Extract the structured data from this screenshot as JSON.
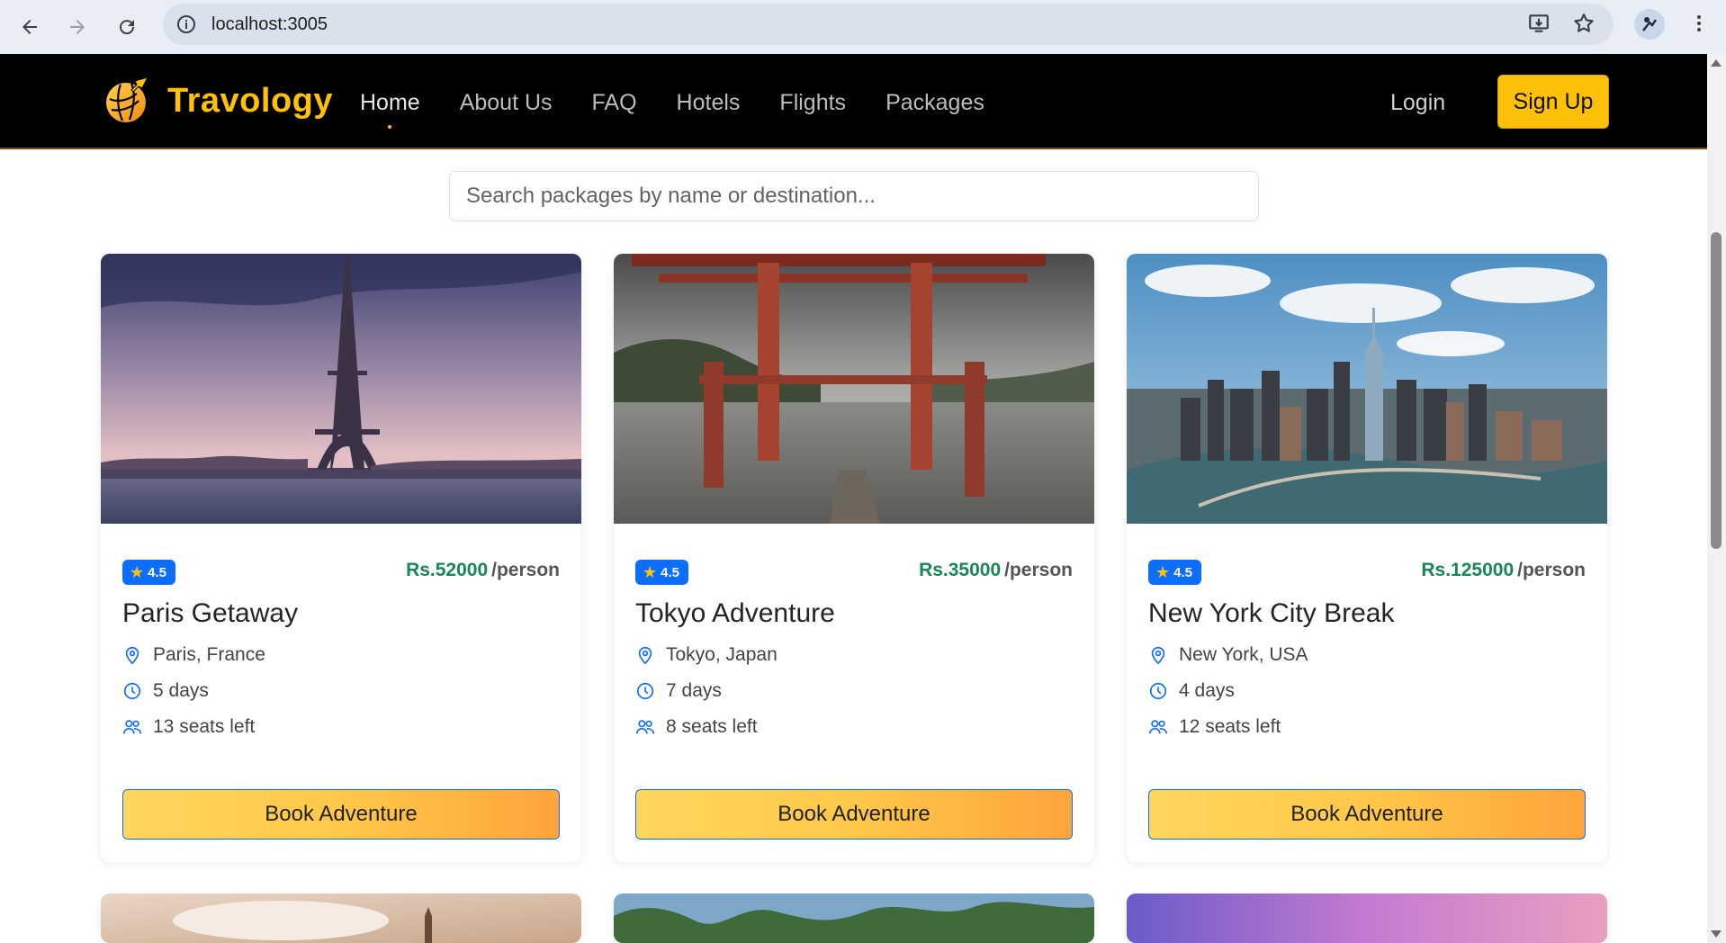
{
  "browser": {
    "url": "localhost:3005",
    "icons": [
      "back-arrow-icon",
      "forward-arrow-icon",
      "reload-icon",
      "site-info-icon",
      "install-app-icon",
      "bookmark-star-icon",
      "profile-icon",
      "menu-dots-icon"
    ]
  },
  "navbar": {
    "brand": "Travology",
    "links": [
      {
        "label": "Home"
      },
      {
        "label": "About Us"
      },
      {
        "label": "FAQ"
      },
      {
        "label": "Hotels"
      },
      {
        "label": "Flights"
      },
      {
        "label": "Packages"
      }
    ],
    "login": "Login",
    "signup": "Sign Up"
  },
  "search": {
    "placeholder": "Search packages by name or destination..."
  },
  "packages": [
    {
      "rating": "4.5",
      "price": "Rs.52000",
      "per": "/person",
      "name": "Paris Getaway",
      "location": "Paris, France",
      "duration": "5 days",
      "seats": "13 seats left",
      "cta": "Book Adventure"
    },
    {
      "rating": "4.5",
      "price": "Rs.35000",
      "per": "/person",
      "name": "Tokyo Adventure",
      "location": "Tokyo, Japan",
      "duration": "7 days",
      "seats": "8 seats left",
      "cta": "Book Adventure"
    },
    {
      "rating": "4.5",
      "price": "Rs.125000",
      "per": "/person",
      "name": "New York City Break",
      "location": "New York, USA",
      "duration": "4 days",
      "seats": "12 seats left",
      "cta": "Book Adventure"
    }
  ],
  "colors": {
    "accent": "#ffc107",
    "primary": "#0d6efd",
    "price": "#198754",
    "navbar_bg": "#000000"
  }
}
